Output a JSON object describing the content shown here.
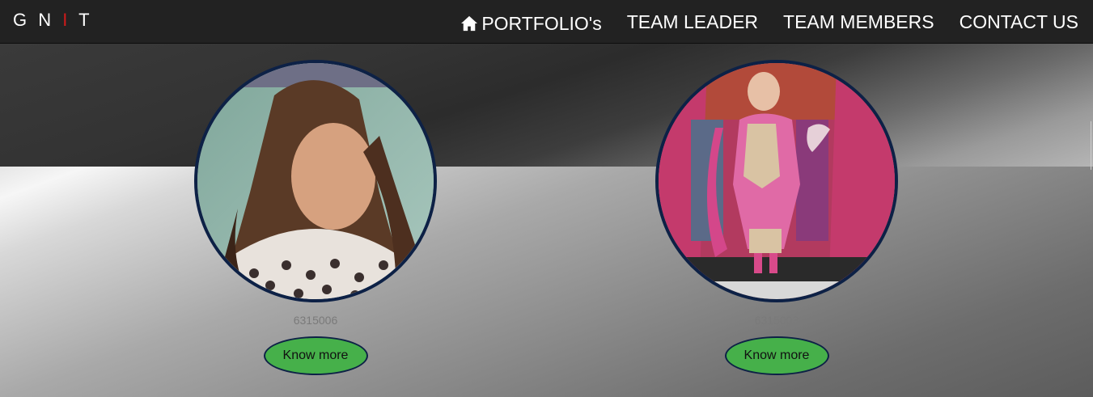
{
  "brand": {
    "letters_1": "G N ",
    "accent": "I",
    "letters_2": " T"
  },
  "nav": {
    "portfolio": "PORTFOLIO's",
    "team_leader": "TEAM LEADER",
    "team_members": "TEAM MEMBERS",
    "contact": "CONTACT US",
    "icon": "home-icon"
  },
  "members": [
    {
      "roll": "6315006",
      "button": "Know more"
    },
    {
      "roll": "6315003",
      "button": "Know more"
    }
  ],
  "colors": {
    "navbar": "#222222",
    "brand_accent": "#d11a1a",
    "button": "#46b04a",
    "avatar_border": "#0d2146"
  }
}
